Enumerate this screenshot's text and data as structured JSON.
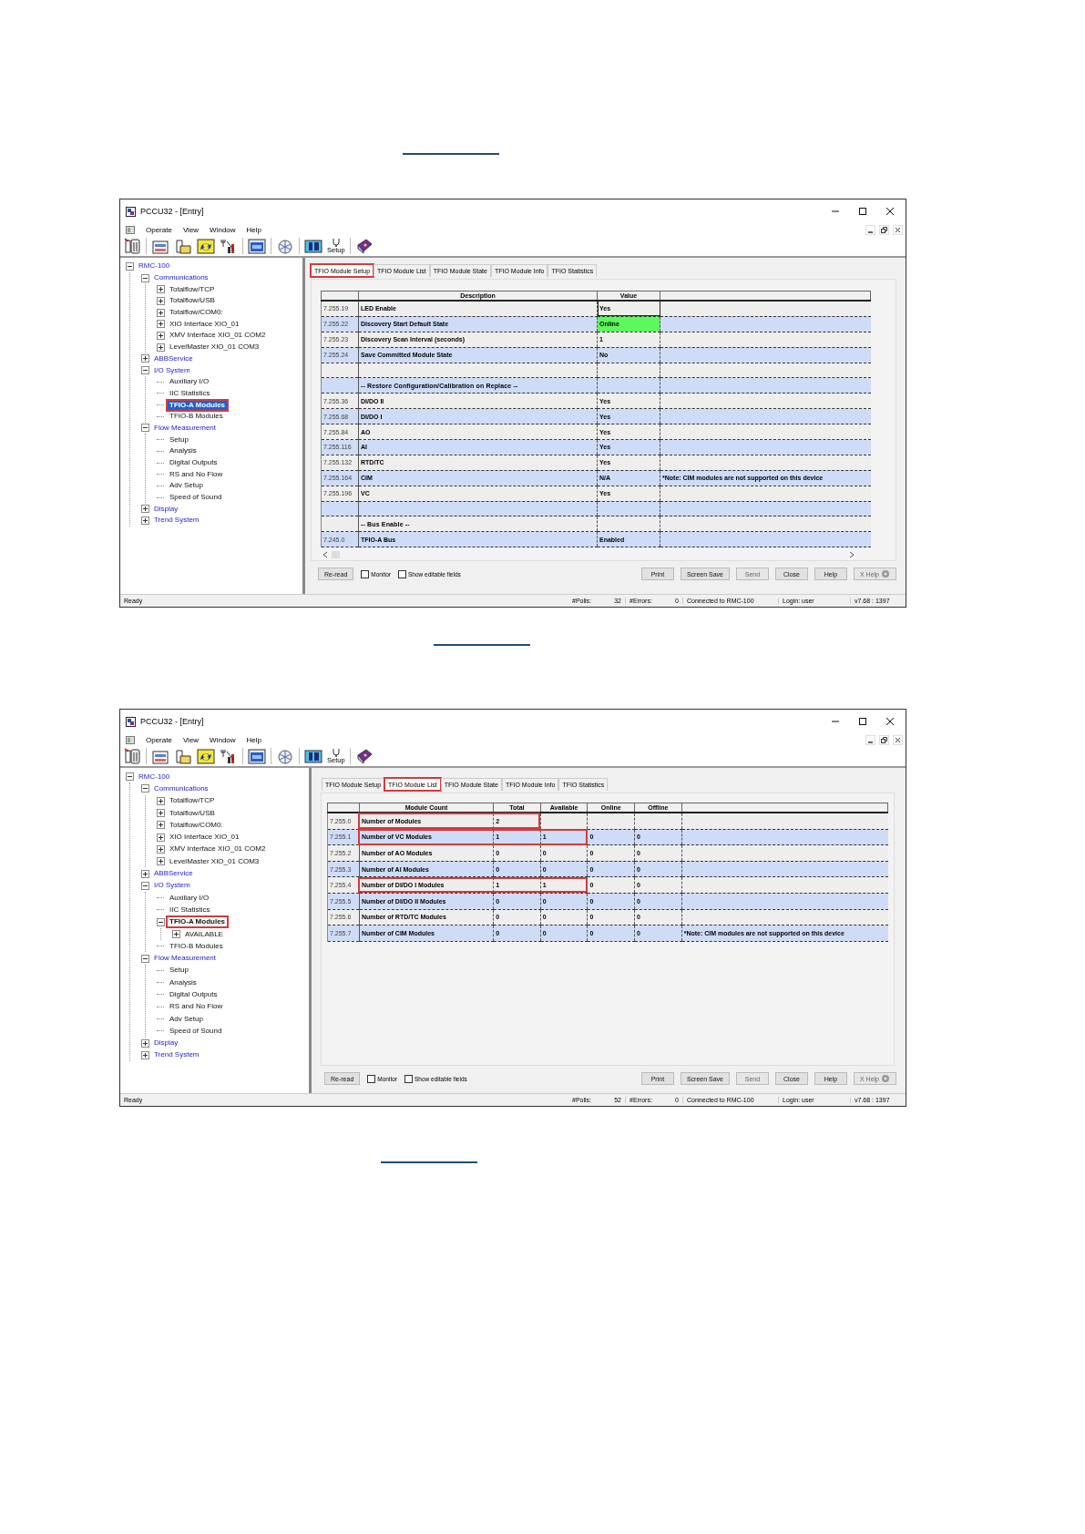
{
  "windows": [
    {
      "title": "PCCU32 - [Entry]",
      "menu": [
        "Operate",
        "View",
        "Window",
        "Help"
      ],
      "toolbar": {
        "caption": "Setup"
      },
      "tree": [
        {
          "label": "RMC-100",
          "kind": "category",
          "expanded": true,
          "selected": false,
          "highlighted": false,
          "children": [
            {
              "label": "Communications",
              "kind": "category",
              "expanded": true,
              "selected": false,
              "highlighted": false,
              "children": [
                {
                  "label": "Totalflow/TCP",
                  "kind": "item",
                  "expanded": false,
                  "selected": false,
                  "highlighted": false
                },
                {
                  "label": "Totalflow/USB",
                  "kind": "item",
                  "expanded": false,
                  "selected": false,
                  "highlighted": false
                },
                {
                  "label": "Totalflow/COM0:",
                  "kind": "item",
                  "expanded": false,
                  "selected": false,
                  "highlighted": false
                },
                {
                  "label": "XIO Interface XIO_01",
                  "kind": "item",
                  "expanded": false,
                  "selected": false,
                  "highlighted": false
                },
                {
                  "label": "XMV Interface XIO_01 COM2",
                  "kind": "item",
                  "expanded": false,
                  "selected": false,
                  "highlighted": false
                },
                {
                  "label": "LevelMaster XIO_01 COM3",
                  "kind": "item",
                  "expanded": false,
                  "selected": false,
                  "highlighted": false
                }
              ]
            },
            {
              "label": "ABBService",
              "kind": "category",
              "expanded": false,
              "selected": false,
              "highlighted": false
            },
            {
              "label": "I/O System",
              "kind": "category",
              "expanded": true,
              "selected": false,
              "highlighted": false,
              "children": [
                {
                  "label": "Auxiliary I/O",
                  "kind": "item",
                  "selected": false,
                  "highlighted": false
                },
                {
                  "label": "IIC Statistics",
                  "kind": "item",
                  "selected": false,
                  "highlighted": false
                },
                {
                  "label": "TFIO-A Modules",
                  "kind": "item",
                  "selected": true,
                  "highlighted": true
                },
                {
                  "label": "TFIO-B Modules",
                  "kind": "item",
                  "selected": false,
                  "highlighted": false
                }
              ]
            },
            {
              "label": "Flow Measurement",
              "kind": "category",
              "expanded": true,
              "selected": false,
              "highlighted": false,
              "children": [
                {
                  "label": "Setup",
                  "kind": "item",
                  "selected": false,
                  "highlighted": false
                },
                {
                  "label": "Analysis",
                  "kind": "item",
                  "selected": false,
                  "highlighted": false
                },
                {
                  "label": "Digital Outputs",
                  "kind": "item",
                  "selected": false,
                  "highlighted": false
                },
                {
                  "label": "RS and No Flow",
                  "kind": "item",
                  "selected": false,
                  "highlighted": false
                },
                {
                  "label": "Adv Setup",
                  "kind": "item",
                  "selected": false,
                  "highlighted": false
                },
                {
                  "label": "Speed of Sound",
                  "kind": "item",
                  "selected": false,
                  "highlighted": false
                }
              ]
            },
            {
              "label": "Display",
              "kind": "category",
              "expanded": false,
              "selected": false,
              "highlighted": false
            },
            {
              "label": "Trend System",
              "kind": "category",
              "expanded": false,
              "selected": false,
              "highlighted": false
            }
          ]
        }
      ],
      "tabs": [
        {
          "label": "TFIO Module Setup",
          "selected": true,
          "highlighted": true
        },
        {
          "label": "TFIO Module List",
          "selected": false,
          "highlighted": false
        },
        {
          "label": "TFIO Module State",
          "selected": false,
          "highlighted": false
        },
        {
          "label": "TFIO Module Info",
          "selected": false,
          "highlighted": false
        },
        {
          "label": "TFIO Statistics",
          "selected": false,
          "highlighted": false
        }
      ],
      "table": {
        "kind": "setup",
        "columns": [
          "Description",
          "Value"
        ],
        "rows": [
          {
            "kind": "data",
            "register": "7.255.19",
            "cells": [
              {
                "text": "LED Enable"
              },
              {
                "text": "Yes",
                "focused": true
              }
            ]
          },
          {
            "kind": "data",
            "register": "7.255.22",
            "cells": [
              {
                "text": "Discovery Start Default State"
              },
              {
                "text": "Online",
                "color": "#5cf85c"
              }
            ]
          },
          {
            "kind": "data",
            "register": "7.255.23",
            "cells": [
              {
                "text": "Discovery Scan Interval (seconds)"
              },
              {
                "text": "1"
              }
            ]
          },
          {
            "kind": "data",
            "register": "7.255.24",
            "cells": [
              {
                "text": "Save Committed Module State"
              },
              {
                "text": "No"
              }
            ]
          },
          {
            "kind": "blank"
          },
          {
            "kind": "section",
            "cells": [
              {
                "text": "-- Restore Configuration/Calibration on Replace --"
              }
            ]
          },
          {
            "kind": "data",
            "register": "7.255.36",
            "cells": [
              {
                "text": "DI/DO II"
              },
              {
                "text": "Yes"
              }
            ]
          },
          {
            "kind": "data",
            "register": "7.255.68",
            "cells": [
              {
                "text": "DI/DO I"
              },
              {
                "text": "Yes"
              }
            ]
          },
          {
            "kind": "data",
            "register": "7.255.84",
            "cells": [
              {
                "text": "AO"
              },
              {
                "text": "Yes"
              }
            ]
          },
          {
            "kind": "data",
            "register": "7.255.116",
            "cells": [
              {
                "text": "AI"
              },
              {
                "text": "Yes"
              }
            ]
          },
          {
            "kind": "data",
            "register": "7.255.132",
            "cells": [
              {
                "text": "RTD/TC"
              },
              {
                "text": "Yes"
              }
            ]
          },
          {
            "kind": "data",
            "register": "7.255.164",
            "cells": [
              {
                "text": "CIM"
              },
              {
                "text": "N/A"
              }
            ],
            "note": "*Note: CIM modules are not supported on this device"
          },
          {
            "kind": "data",
            "register": "7.255.196",
            "cells": [
              {
                "text": "VC"
              },
              {
                "text": "Yes"
              }
            ]
          },
          {
            "kind": "blank"
          },
          {
            "kind": "section",
            "cells": [
              {
                "text": "-- Bus Enable --"
              }
            ]
          },
          {
            "kind": "data",
            "register": "7.245.0",
            "cells": [
              {
                "text": "TFIO-A Bus"
              },
              {
                "text": "Enabled"
              }
            ]
          }
        ]
      },
      "checks": [
        {
          "label": "Monitor",
          "checked": false
        },
        {
          "label": "Show editable fields",
          "checked": false
        }
      ],
      "left_buttons": [
        {
          "label": "Re-read",
          "disabled": false
        }
      ],
      "buttons": [
        {
          "label": "Print",
          "disabled": false
        },
        {
          "label": "Screen Save",
          "disabled": false
        },
        {
          "label": "Send",
          "disabled": true
        },
        {
          "label": "Close",
          "disabled": false
        },
        {
          "label": "Help",
          "disabled": false
        },
        {
          "label": "X Help",
          "disabled": true,
          "has_icon": true
        }
      ],
      "status": {
        "message": "Ready",
        "polls_label": "#Polls:",
        "polls": "32",
        "errors_label": "#Errors:",
        "errors": "0",
        "connection": "Connected to RMC-100",
        "login": "Login: user",
        "version": "v7.68 : 1397"
      }
    },
    {
      "title": "PCCU32 - [Entry]",
      "menu": [
        "Operate",
        "View",
        "Window",
        "Help"
      ],
      "toolbar": {
        "caption": "Setup"
      },
      "tree": [
        {
          "label": "RMC-100",
          "kind": "category",
          "expanded": true,
          "selected": false,
          "highlighted": false,
          "children": [
            {
              "label": "Communications",
              "kind": "category",
              "expanded": true,
              "selected": false,
              "highlighted": false,
              "children": [
                {
                  "label": "Totalflow/TCP",
                  "kind": "item",
                  "expanded": false,
                  "selected": false,
                  "highlighted": false
                },
                {
                  "label": "Totalflow/USB",
                  "kind": "item",
                  "expanded": false,
                  "selected": false,
                  "highlighted": false
                },
                {
                  "label": "Totalflow/COM0:",
                  "kind": "item",
                  "expanded": false,
                  "selected": false,
                  "highlighted": false
                },
                {
                  "label": "XIO Interface XIO_01",
                  "kind": "item",
                  "expanded": false,
                  "selected": false,
                  "highlighted": false
                },
                {
                  "label": "XMV Interface XIO_01 COM2",
                  "kind": "item",
                  "expanded": false,
                  "selected": false,
                  "highlighted": false
                },
                {
                  "label": "LevelMaster XIO_01 COM3",
                  "kind": "item",
                  "expanded": false,
                  "selected": false,
                  "highlighted": false
                }
              ]
            },
            {
              "label": "ABBService",
              "kind": "category",
              "expanded": false,
              "selected": false,
              "highlighted": false
            },
            {
              "label": "I/O System",
              "kind": "category",
              "expanded": true,
              "selected": false,
              "highlighted": false,
              "children": [
                {
                  "label": "Auxiliary I/O",
                  "kind": "item",
                  "selected": false,
                  "highlighted": false
                },
                {
                  "label": "IIC Statistics",
                  "kind": "item",
                  "selected": false,
                  "highlighted": false
                },
                {
                  "label": "TFIO-A Modules",
                  "kind": "item",
                  "expanded": true,
                  "selected": false,
                  "highlighted": true,
                  "emphasized": true,
                  "children": [
                    {
                      "label": "AVAILABLE",
                      "kind": "item",
                      "expanded": false,
                      "selected": false,
                      "highlighted": false
                    }
                  ]
                },
                {
                  "label": "TFIO-B Modules",
                  "kind": "item",
                  "selected": false,
                  "highlighted": false
                }
              ]
            },
            {
              "label": "Flow Measurement",
              "kind": "category",
              "expanded": true,
              "selected": false,
              "highlighted": false,
              "children": [
                {
                  "label": "Setup",
                  "kind": "item",
                  "selected": false,
                  "highlighted": false
                },
                {
                  "label": "Analysis",
                  "kind": "item",
                  "selected": false,
                  "highlighted": false
                },
                {
                  "label": "Digital Outputs",
                  "kind": "item",
                  "selected": false,
                  "highlighted": false
                },
                {
                  "label": "RS and No Flow",
                  "kind": "item",
                  "selected": false,
                  "highlighted": false
                },
                {
                  "label": "Adv Setup",
                  "kind": "item",
                  "selected": false,
                  "highlighted": false
                },
                {
                  "label": "Speed of Sound",
                  "kind": "item",
                  "selected": false,
                  "highlighted": false
                }
              ]
            },
            {
              "label": "Display",
              "kind": "category",
              "expanded": false,
              "selected": false,
              "highlighted": false
            },
            {
              "label": "Trend System",
              "kind": "category",
              "expanded": false,
              "selected": false,
              "highlighted": false
            }
          ]
        }
      ],
      "tabs": [
        {
          "label": "TFIO Module Setup",
          "selected": false,
          "highlighted": false
        },
        {
          "label": "TFIO Module List",
          "selected": true,
          "highlighted": true
        },
        {
          "label": "TFIO Module State",
          "selected": false,
          "highlighted": false
        },
        {
          "label": "TFIO Module Info",
          "selected": false,
          "highlighted": false
        },
        {
          "label": "TFIO Statistics",
          "selected": false,
          "highlighted": false
        }
      ],
      "table": {
        "kind": "list",
        "columns": [
          "Module Count",
          "Total",
          "Available",
          "Online",
          "Offline"
        ],
        "rows": [
          {
            "kind": "data",
            "register": "7.255.0",
            "cells": [
              {
                "text": "Number of Modules",
                "highlighted": true
              },
              {
                "text": "2",
                "highlighted": true
              },
              {
                "highlighted": false
              },
              {
                "highlighted": false
              },
              {
                "highlighted": false
              }
            ]
          },
          {
            "kind": "data",
            "register": "7.255.1",
            "cells": [
              {
                "text": "Number of VC Modules",
                "highlighted": true
              },
              {
                "text": "1",
                "highlighted": true
              },
              {
                "text": "1",
                "highlighted": true
              },
              {
                "text": "0",
                "highlighted": false
              },
              {
                "text": "0",
                "highlighted": false
              }
            ]
          },
          {
            "kind": "data",
            "register": "7.255.2",
            "cells": [
              {
                "text": "Number of AO Modules",
                "highlighted": false
              },
              {
                "text": "0",
                "highlighted": false
              },
              {
                "text": "0",
                "highlighted": false
              },
              {
                "text": "0",
                "highlighted": false
              },
              {
                "text": "0",
                "highlighted": false
              }
            ]
          },
          {
            "kind": "data",
            "register": "7.255.3",
            "cells": [
              {
                "text": "Number of AI Modules",
                "highlighted": false
              },
              {
                "text": "0",
                "highlighted": false
              },
              {
                "text": "0",
                "highlighted": false
              },
              {
                "text": "0",
                "highlighted": false
              },
              {
                "text": "0",
                "highlighted": false
              }
            ]
          },
          {
            "kind": "data",
            "register": "7.255.4",
            "cells": [
              {
                "text": "Number of DI/DO I Modules",
                "highlighted": true
              },
              {
                "text": "1",
                "highlighted": true
              },
              {
                "text": "1",
                "highlighted": true
              },
              {
                "text": "0",
                "highlighted": false
              },
              {
                "text": "0",
                "highlighted": false
              }
            ]
          },
          {
            "kind": "data",
            "register": "7.255.5",
            "cells": [
              {
                "text": "Number of DI/DO II Modules",
                "highlighted": false
              },
              {
                "text": "0",
                "highlighted": false
              },
              {
                "text": "0",
                "highlighted": false
              },
              {
                "text": "0",
                "highlighted": false
              },
              {
                "text": "0",
                "highlighted": false
              }
            ]
          },
          {
            "kind": "data",
            "register": "7.255.6",
            "cells": [
              {
                "text": "Number of RTD/TC Modules",
                "highlighted": false
              },
              {
                "text": "0",
                "highlighted": false
              },
              {
                "text": "0",
                "highlighted": false
              },
              {
                "text": "0",
                "highlighted": false
              },
              {
                "text": "0",
                "highlighted": false
              }
            ]
          },
          {
            "kind": "data",
            "register": "7.255.7",
            "cells": [
              {
                "text": "Number of CIM Modules",
                "highlighted": false
              },
              {
                "text": "0",
                "highlighted": false
              },
              {
                "text": "0",
                "highlighted": false
              },
              {
                "text": "0",
                "highlighted": false
              },
              {
                "text": "0",
                "highlighted": false
              }
            ],
            "note": "*Note: CIM modules are not supported on this device"
          }
        ]
      },
      "checks": [
        {
          "label": "Monitor",
          "checked": false
        },
        {
          "label": "Show editable fields",
          "checked": false
        }
      ],
      "left_buttons": [
        {
          "label": "Re-read",
          "disabled": false
        }
      ],
      "buttons": [
        {
          "label": "Print",
          "disabled": false
        },
        {
          "label": "Screen Save",
          "disabled": false
        },
        {
          "label": "Send",
          "disabled": true
        },
        {
          "label": "Close",
          "disabled": false
        },
        {
          "label": "Help",
          "disabled": false
        },
        {
          "label": "X Help",
          "disabled": true,
          "has_icon": true
        }
      ],
      "status": {
        "message": "Ready",
        "polls_label": "#Polls:",
        "polls": "52",
        "errors_label": "#Errors:",
        "errors": "0",
        "connection": "Connected to RMC-100",
        "login": "Login: user",
        "version": "v7.68 : 1397"
      }
    }
  ]
}
